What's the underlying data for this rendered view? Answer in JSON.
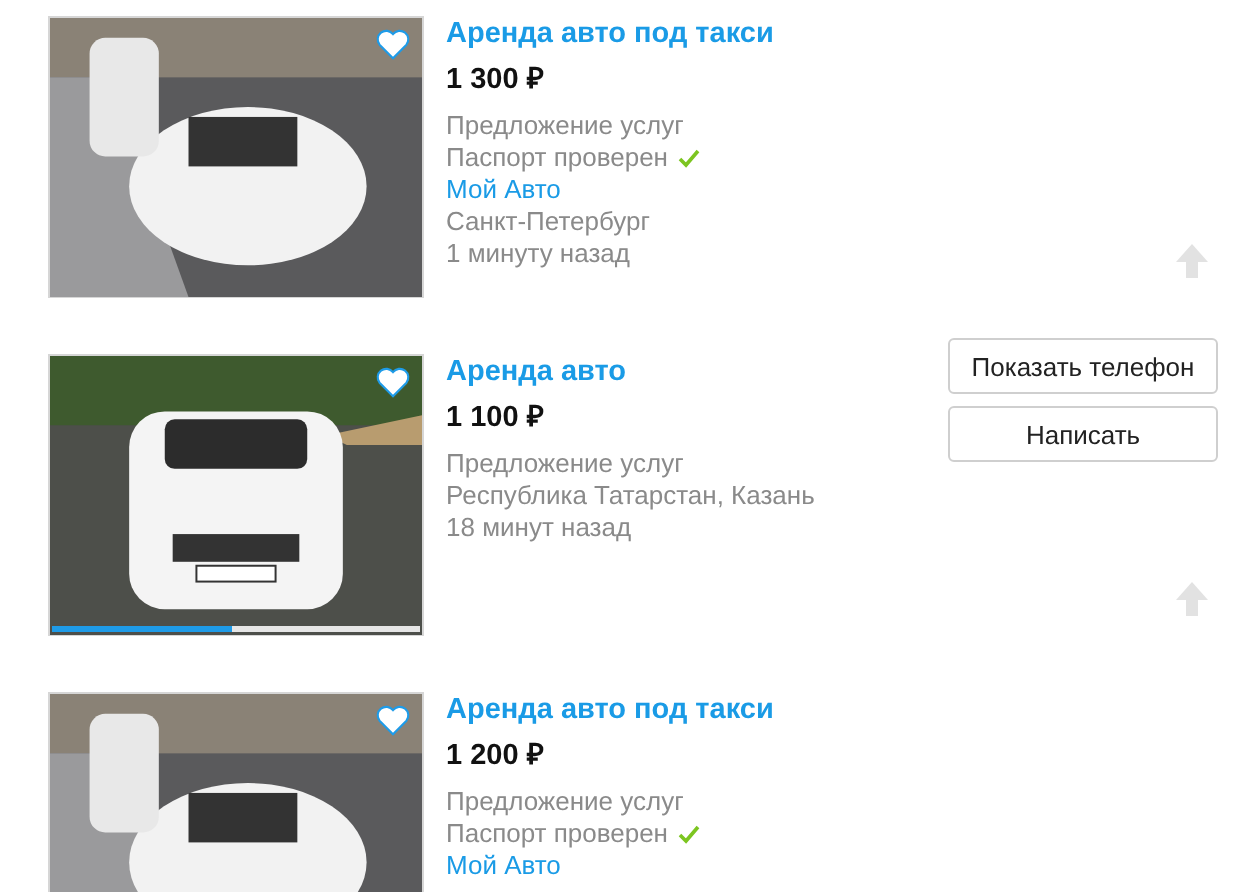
{
  "listings": [
    {
      "title": "Аренда авто под такси",
      "price": "1 300 ₽",
      "favorite": true,
      "photo": {
        "kind": "street"
      },
      "lines": [
        {
          "kind": "detail",
          "text": "Предложение услуг"
        },
        {
          "kind": "verified",
          "text": "Паспорт проверен"
        },
        {
          "kind": "link",
          "text": "Мой Авто"
        },
        {
          "kind": "detail",
          "text": "Санкт-Петербург"
        },
        {
          "kind": "detail",
          "text": "1 минуту назад"
        }
      ]
    },
    {
      "title": "Аренда авто",
      "price": "1 100 ₽",
      "favorite": true,
      "photo": {
        "kind": "lot",
        "level": 0.49
      },
      "lines": [
        {
          "kind": "detail",
          "text": "Предложение услуг"
        },
        {
          "kind": "detail",
          "text": "Республика Татарстан, Казань"
        },
        {
          "kind": "detail",
          "text": "18 минут назад"
        }
      ],
      "buttons": [
        "Показать телефон",
        "Написать"
      ]
    },
    {
      "title": "Аренда авто под такси",
      "price": "1 200 ₽",
      "favorite": true,
      "photo": {
        "kind": "street"
      },
      "lines": [
        {
          "kind": "detail",
          "text": "Предложение услуг"
        },
        {
          "kind": "verified",
          "text": "Паспорт проверен"
        },
        {
          "kind": "link",
          "text": "Мой Авто"
        }
      ]
    }
  ]
}
